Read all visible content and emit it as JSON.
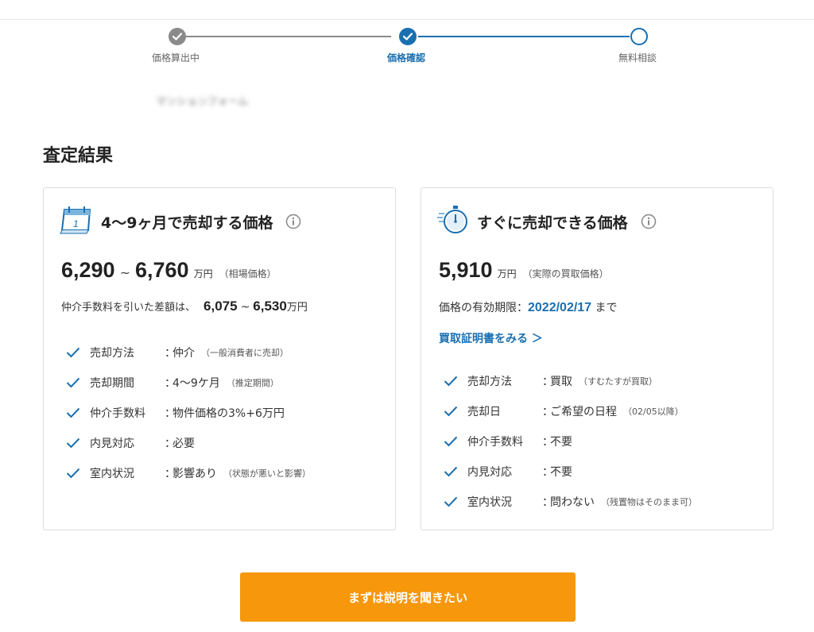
{
  "stepper": {
    "steps": [
      {
        "label": "価格算出中",
        "state": "done"
      },
      {
        "label": "価格確認",
        "state": "current"
      },
      {
        "label": "無料相談",
        "state": "pending"
      }
    ],
    "colors": {
      "done": "#8a8a8a",
      "active": "#1a6fb0"
    }
  },
  "blurred_text": "マンションフォーム",
  "section_title": "査定結果",
  "left_card": {
    "icon": "calendar-icon",
    "title": "4〜9ヶ月で売却する価格",
    "price_min": "6,290",
    "price_sep": "~",
    "price_max": "6,760",
    "price_unit": "万円",
    "price_note": "（相場価格）",
    "net_label": "仲介手数料を引いた差額は、",
    "net_min": "6,075",
    "net_sep": "~",
    "net_max": "6,530",
    "net_unit": "万円",
    "features": [
      {
        "label": "売却方法",
        "value": "仲介",
        "note": "（一般消費者に売却）"
      },
      {
        "label": "売却期間",
        "value": "4〜9ケ月",
        "note": "（推定期間）"
      },
      {
        "label": "仲介手数料",
        "value": "物件価格の3%+6万円",
        "note": ""
      },
      {
        "label": "内見対応",
        "value": "必要",
        "note": ""
      },
      {
        "label": "室内状況",
        "value": "影響あり",
        "note": "（状態が悪いと影響）"
      }
    ]
  },
  "right_card": {
    "icon": "stopwatch-icon",
    "title": "すぐに売却できる価格",
    "price": "5,910",
    "price_unit": "万円",
    "price_note": "（実際の買取価格）",
    "validity_label": "価格の有効期限：",
    "validity_date": "2022/02/17",
    "validity_suffix": " まで",
    "cert_link": "買取証明書をみる ＞",
    "features": [
      {
        "label": "売却方法",
        "value": "買取",
        "note": "（すむたすが買取）"
      },
      {
        "label": "売却日",
        "value": "ご希望の日程",
        "note": "（02/05以降）"
      },
      {
        "label": "仲介手数料",
        "value": "不要",
        "note": ""
      },
      {
        "label": "内見対応",
        "value": "不要",
        "note": ""
      },
      {
        "label": "室内状況",
        "value": "問わない",
        "note": "（残置物はそのまま可）"
      }
    ]
  },
  "colon": "：",
  "cta_label": "まずは説明を聞きたい",
  "colors": {
    "accent_blue": "#1a6fb0",
    "cta_orange": "#f7970c"
  }
}
